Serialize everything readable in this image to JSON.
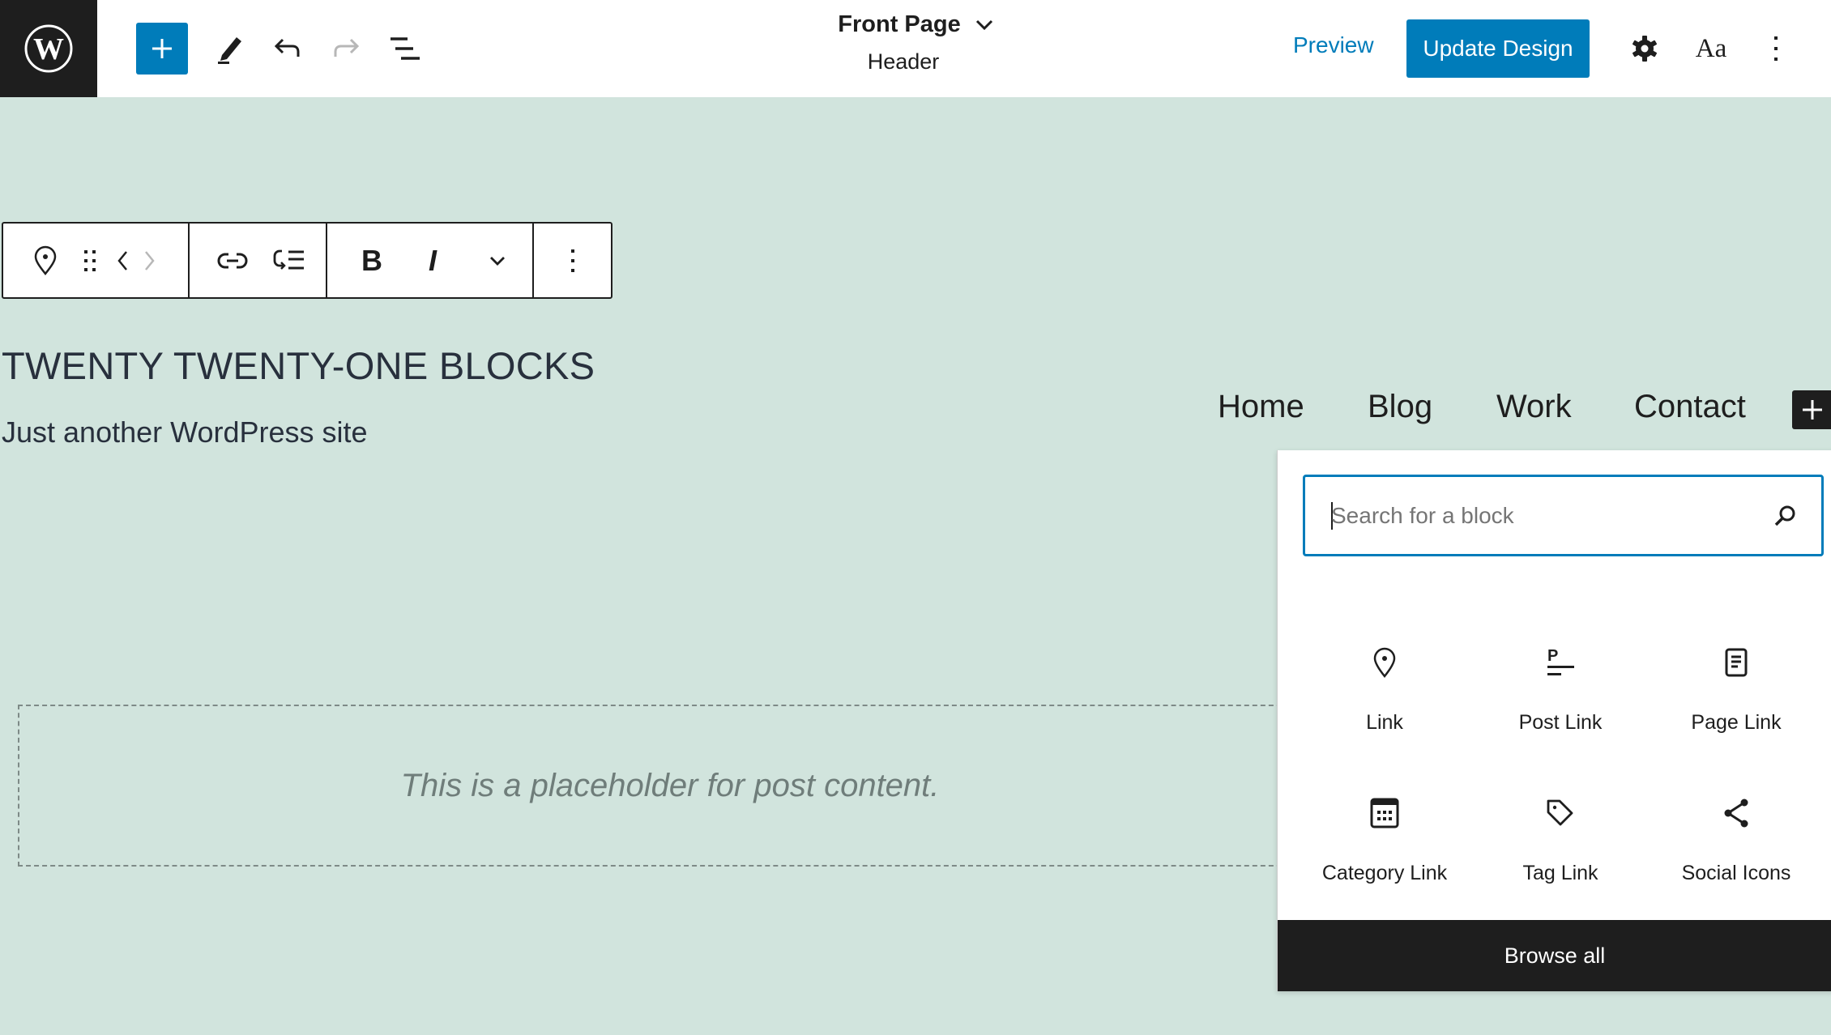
{
  "topbar": {
    "logo": "wordpress-logo",
    "inserter_icon": "plus-icon",
    "tools": [
      "pencil-icon",
      "undo-icon",
      "redo-icon",
      "list-view-icon"
    ],
    "document": {
      "title": "Front Page",
      "subtitle": "Header"
    },
    "preview_label": "Preview",
    "update_label": "Update Design",
    "styles_label": "Aa"
  },
  "block_toolbar": {
    "groups": [
      [
        "map-pin-icon",
        "drag-handle-icon",
        "chevron-left-icon",
        "chevron-right-icon"
      ],
      [
        "link-icon",
        "submenu-icon"
      ],
      [
        "bold-icon",
        "italic-icon",
        "chevron-down-icon"
      ],
      [
        "more-vertical-icon"
      ]
    ]
  },
  "site": {
    "title": "TWENTY TWENTY-ONE BLOCKS",
    "tagline": "Just another WordPress site"
  },
  "navigation": {
    "items": [
      {
        "label": "Home"
      },
      {
        "label": "Blog"
      },
      {
        "label": "Work"
      },
      {
        "label": "Contact"
      }
    ]
  },
  "post_content": {
    "placeholder": "This is a placeholder for post content."
  },
  "inserter": {
    "search": {
      "placeholder": "Search for a block",
      "value": ""
    },
    "blocks": [
      {
        "label": "Link",
        "icon": "map-pin-icon"
      },
      {
        "label": "Post Link",
        "icon": "post-link-icon"
      },
      {
        "label": "Page Link",
        "icon": "page-icon"
      },
      {
        "label": "Category Link",
        "icon": "category-icon"
      },
      {
        "label": "Tag Link",
        "icon": "tag-icon"
      },
      {
        "label": "Social Icons",
        "icon": "share-icon"
      }
    ],
    "browse_all_label": "Browse all"
  },
  "colors": {
    "accent": "#007cba",
    "dark": "#1e1e1e",
    "canvas_bg": "#d1e4dd",
    "site_text": "#28303d"
  }
}
